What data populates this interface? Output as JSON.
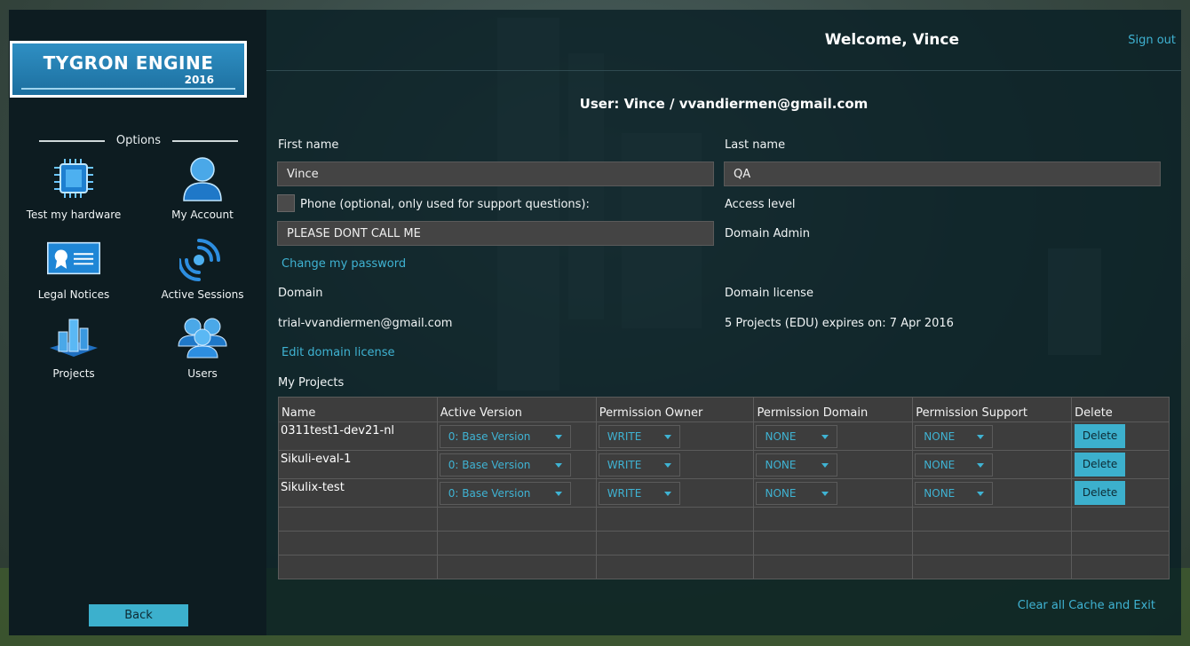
{
  "logo": {
    "title": "TYGRON ENGINE",
    "year": "2016"
  },
  "sidebar": {
    "options_title": "Options",
    "items": [
      {
        "label": "Test my hardware",
        "icon": "chip-icon"
      },
      {
        "label": "My Account",
        "icon": "user-icon"
      },
      {
        "label": "Legal Notices",
        "icon": "certificate-icon"
      },
      {
        "label": "Active Sessions",
        "icon": "signal-icon"
      },
      {
        "label": "Projects",
        "icon": "city-icon"
      },
      {
        "label": "Users",
        "icon": "users-icon"
      }
    ],
    "back_label": "Back"
  },
  "header": {
    "welcome": "Welcome, Vince",
    "signout": "Sign out"
  },
  "user": {
    "title": "User: Vince / vvandiermen@gmail.com",
    "first_name_label": "First name",
    "first_name": "Vince",
    "last_name_label": "Last name",
    "last_name": "QA",
    "phone_label": "Phone (optional, only used for support questions):",
    "phone": "PLEASE DONT CALL ME",
    "access_label": "Access level",
    "access_value": "Domain Admin",
    "change_password": "Change my password",
    "domain_label": "Domain",
    "domain_value": "trial-vvandiermen@gmail.com",
    "license_label": "Domain license",
    "license_value": "5 Projects (EDU) expires on: 7 Apr 2016",
    "edit_license": "Edit domain license"
  },
  "projects": {
    "title": "My Projects",
    "columns": [
      "Name",
      "Active Version",
      "Permission Owner",
      "Permission Domain",
      "Permission Support",
      "Delete"
    ],
    "rows": [
      {
        "name": "0311test1-dev21-nl",
        "version": "0: Base Version",
        "owner": "WRITE",
        "domain": "NONE",
        "support": "NONE",
        "delete": "Delete"
      },
      {
        "name": "Sikuli-eval-1",
        "version": "0: Base Version",
        "owner": "WRITE",
        "domain": "NONE",
        "support": "NONE",
        "delete": "Delete"
      },
      {
        "name": "Sikulix-test",
        "version": "0: Base Version",
        "owner": "WRITE",
        "domain": "NONE",
        "support": "NONE",
        "delete": "Delete"
      }
    ]
  },
  "footer": {
    "clear_cache": "Clear all Cache and Exit"
  }
}
